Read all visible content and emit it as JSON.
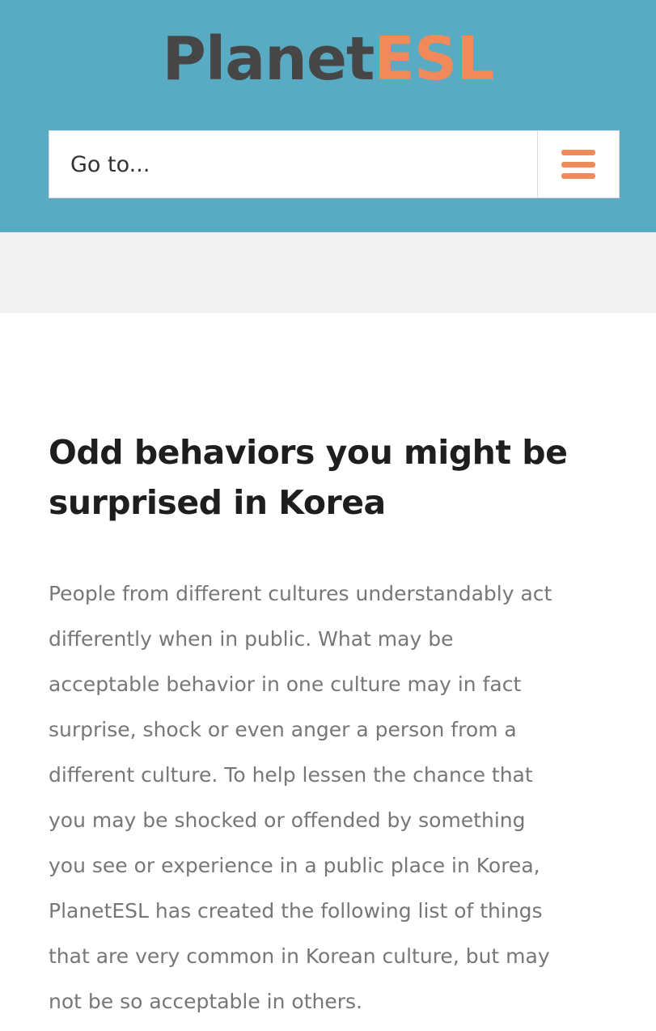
{
  "header": {
    "logo": {
      "part_a": "Planet",
      "part_b": "ESL"
    },
    "nav_select": {
      "label": "Go to...",
      "toggle_icon": "hamburger-menu-icon"
    },
    "colors": {
      "background": "#58abc2",
      "logo_dark": "#464646",
      "accent": "#f08a5b"
    }
  },
  "article": {
    "title_lines": [
      "Odd behaviors you might be",
      "surprised in Korea"
    ],
    "body_lines": [
      "People from different cultures understandably act",
      "differently when in public. What may be",
      "acceptable behavior in one culture may in fact",
      "surprise, shock or even anger a person from a",
      "different culture. To help lessen the chance that",
      "you may be shocked or offended by something",
      "you see or experience in a public place in Korea,",
      "PlanetESL has created the following list of things",
      "that are very common in Korean culture, but may",
      "not be so acceptable in others."
    ]
  }
}
